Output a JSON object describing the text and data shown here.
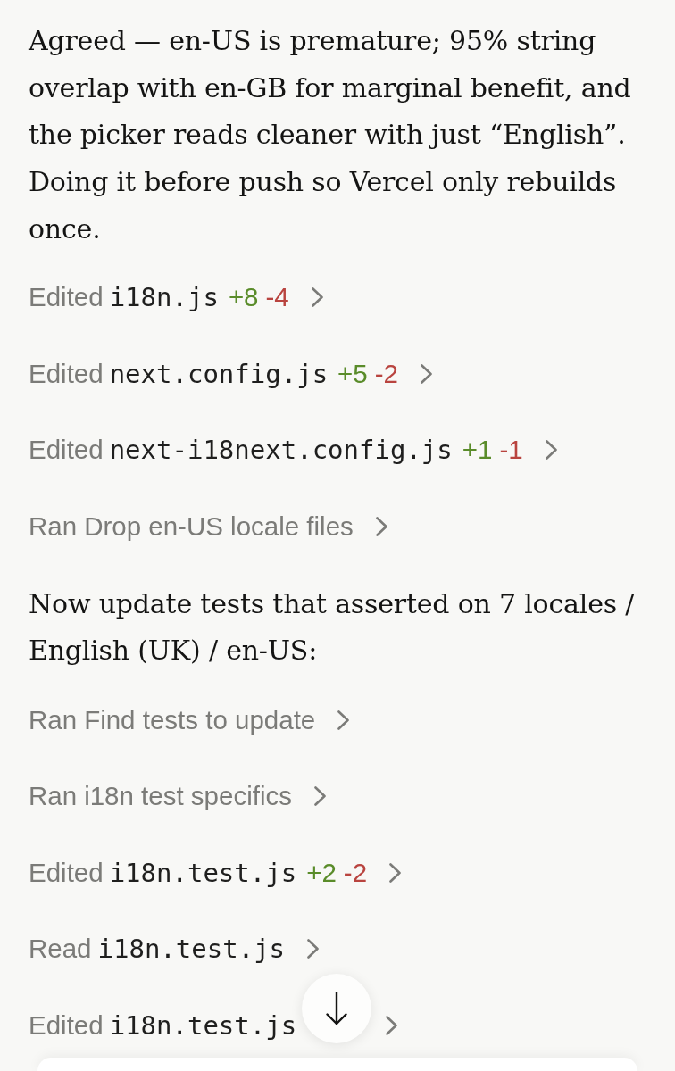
{
  "messages": [
    {
      "kind": "text",
      "text": "Agreed — en-US is premature; 95% string overlap with en-GB for marginal benefit, and the picker reads cleaner with just “English”. Doing it before push so Vercel only rebuilds once."
    },
    {
      "kind": "tool",
      "verb": "Edited",
      "file": "i18n.js",
      "added": "+8",
      "removed": "-4"
    },
    {
      "kind": "tool",
      "verb": "Edited",
      "file": "next.config.js",
      "added": "+5",
      "removed": "-2"
    },
    {
      "kind": "tool",
      "verb": "Edited",
      "file": "next-i18next.config.js",
      "added": "+1",
      "removed": "-1"
    },
    {
      "kind": "tool",
      "verb": "Ran",
      "description": "Drop en-US locale files"
    },
    {
      "kind": "text",
      "text": "Now update tests that asserted on 7 locales / English (UK) / en-US:"
    },
    {
      "kind": "tool",
      "verb": "Ran",
      "description": "Find tests to update"
    },
    {
      "kind": "tool",
      "verb": "Ran",
      "description": "i18n test specifics"
    },
    {
      "kind": "tool",
      "verb": "Edited",
      "file": "i18n.test.js",
      "added": "+2",
      "removed": "-2"
    },
    {
      "kind": "tool",
      "verb": "Read",
      "file": "i18n.test.js"
    },
    {
      "kind": "tool",
      "verb": "Edited",
      "file": "i18n.test.js",
      "diff_covered": true
    }
  ]
}
